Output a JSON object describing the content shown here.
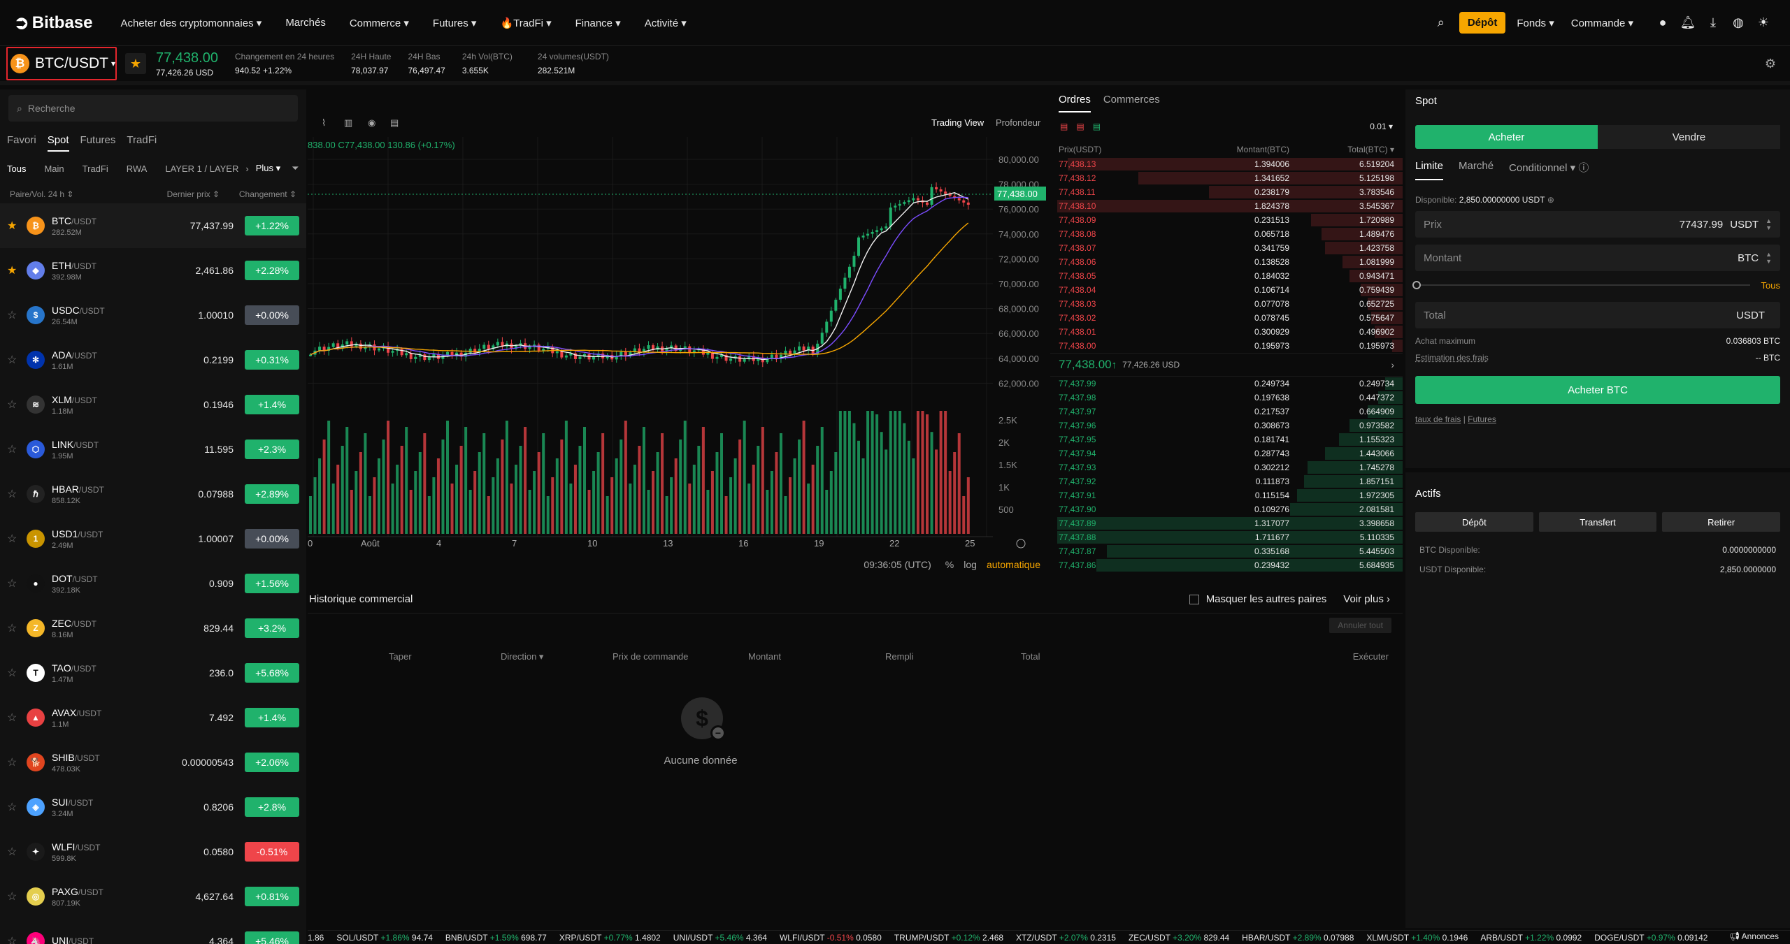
{
  "brand": {
    "name": "Bitbase"
  },
  "nav": {
    "items": [
      "Acheter des cryptomonnaies",
      "Marchés",
      "Commerce",
      "Futures",
      "TradFi",
      "Finance",
      "Activité"
    ]
  },
  "topright": {
    "depot": "Dépôt",
    "fonds": "Fonds",
    "commande": "Commande"
  },
  "ticker": {
    "pair": "BTC/USDT",
    "price": "77,438.00",
    "price_usd": "77,426.26 USD",
    "change_label": "Changement en 24 heures",
    "change_value": "940.52 +1.22%",
    "high_label": "24H Haute",
    "high_value": "78,037.97",
    "low_label": "24H Bas",
    "low_value": "76,497.47",
    "volbtc_label": "24h Vol(BTC)",
    "volbtc_value": "3.655K",
    "volusdt_label": "24 volumes(USDT)",
    "volusdt_value": "282.521M"
  },
  "market": {
    "search_placeholder": "Recherche",
    "tabs": [
      "Favori",
      "Spot",
      "Futures",
      "TradFi"
    ],
    "subtabs": [
      "Tous",
      "Main",
      "TradFi",
      "RWA",
      "LAYER 1 / LAYER"
    ],
    "plus": "Plus",
    "col_pair": "Paire/Vol. 24 h",
    "col_price": "Dernier prix",
    "col_change": "Changement",
    "rows": [
      {
        "base": "BTC",
        "quote": "/USDT",
        "vol": "282.52M",
        "price": "77,437.99",
        "change": "+1.22%",
        "dir": "up",
        "fav": true,
        "color": "#f7931a",
        "sym": "₿"
      },
      {
        "base": "ETH",
        "quote": "/USDT",
        "vol": "392.98M",
        "price": "2,461.86",
        "change": "+2.28%",
        "dir": "up",
        "fav": true,
        "color": "#627eea",
        "sym": "◆"
      },
      {
        "base": "USDC",
        "quote": "/USDT",
        "vol": "26.54M",
        "price": "1.00010",
        "change": "+0.00%",
        "dir": "flat",
        "fav": false,
        "color": "#2775ca",
        "sym": "$"
      },
      {
        "base": "ADA",
        "quote": "/USDT",
        "vol": "1.61M",
        "price": "0.2199",
        "change": "+0.31%",
        "dir": "up",
        "fav": false,
        "color": "#0033ad",
        "sym": "✻"
      },
      {
        "base": "XLM",
        "quote": "/USDT",
        "vol": "1.18M",
        "price": "0.1946",
        "change": "+1.4%",
        "dir": "up",
        "fav": false,
        "color": "#333",
        "sym": "≋"
      },
      {
        "base": "LINK",
        "quote": "/USDT",
        "vol": "1.95M",
        "price": "11.595",
        "change": "+2.3%",
        "dir": "up",
        "fav": false,
        "color": "#2a5ada",
        "sym": "⬡"
      },
      {
        "base": "HBAR",
        "quote": "/USDT",
        "vol": "858.12K",
        "price": "0.07988",
        "change": "+2.89%",
        "dir": "up",
        "fav": false,
        "color": "#222",
        "sym": "ℏ"
      },
      {
        "base": "USD1",
        "quote": "/USDT",
        "vol": "2.49M",
        "price": "1.00007",
        "change": "+0.00%",
        "dir": "flat",
        "fav": false,
        "color": "#c99400",
        "sym": "1"
      },
      {
        "base": "DOT",
        "quote": "/USDT",
        "vol": "392.18K",
        "price": "0.909",
        "change": "+1.56%",
        "dir": "up",
        "fav": false,
        "color": "#111",
        "sym": "●"
      },
      {
        "base": "ZEC",
        "quote": "/USDT",
        "vol": "8.16M",
        "price": "829.44",
        "change": "+3.2%",
        "dir": "up",
        "fav": false,
        "color": "#f4b728",
        "sym": "Z"
      },
      {
        "base": "TAO",
        "quote": "/USDT",
        "vol": "1.47M",
        "price": "236.0",
        "change": "+5.68%",
        "dir": "up",
        "fav": false,
        "color": "#fff",
        "sym": "T"
      },
      {
        "base": "AVAX",
        "quote": "/USDT",
        "vol": "1.1M",
        "price": "7.492",
        "change": "+1.4%",
        "dir": "up",
        "fav": false,
        "color": "#e84142",
        "sym": "▲"
      },
      {
        "base": "SHIB",
        "quote": "/USDT",
        "vol": "478.03K",
        "price": "0.00000543",
        "change": "+2.06%",
        "dir": "up",
        "fav": false,
        "color": "#e0451f",
        "sym": "🐕"
      },
      {
        "base": "SUI",
        "quote": "/USDT",
        "vol": "3.24M",
        "price": "0.8206",
        "change": "+2.8%",
        "dir": "up",
        "fav": false,
        "color": "#4da2ff",
        "sym": "◈"
      },
      {
        "base": "WLFI",
        "quote": "/USDT",
        "vol": "599.8K",
        "price": "0.0580",
        "change": "-0.51%",
        "dir": "down",
        "fav": false,
        "color": "#1a1a1a",
        "sym": "✦"
      },
      {
        "base": "PAXG",
        "quote": "/USDT",
        "vol": "807.19K",
        "price": "4,627.64",
        "change": "+0.81%",
        "dir": "up",
        "fav": false,
        "color": "#e4ce4e",
        "sym": "◎"
      },
      {
        "base": "UNI",
        "quote": "/USDT",
        "vol": "",
        "price": "4.364",
        "change": "+5.46%",
        "dir": "up",
        "fav": false,
        "color": "#ff007a",
        "sym": "🦄"
      }
    ]
  },
  "chart": {
    "trading_view": "Trading View",
    "profondeur": "Profondeur",
    "ohlc": "838.00  C77,438.00  130.86 (+0.17%)",
    "price_axis": [
      "80,000.00",
      "78,000.00",
      "76,000.00",
      "74,000.00",
      "72,000.00",
      "70,000.00",
      "68,000.00",
      "66,000.00",
      "64,000.00",
      "62,000.00"
    ],
    "current_price_tag": "77,438.00",
    "vol_axis": [
      "2.5K",
      "2K",
      "1.5K",
      "1K",
      "500"
    ],
    "x_axis": [
      "0",
      "Août",
      "4",
      "7",
      "10",
      "13",
      "16",
      "19",
      "22",
      "25"
    ],
    "time": "09:36:05 (UTC)",
    "pct": "%",
    "log": "log",
    "auto": "automatique"
  },
  "orderbook": {
    "tabs": [
      "Ordres",
      "Commerces"
    ],
    "precision": "0.01",
    "col_price": "Prix(USDT)",
    "col_amount": "Montant(BTC)",
    "col_total": "Total(BTC)",
    "asks": [
      [
        "77,438.13",
        "1.394006",
        "6.519204",
        0.95
      ],
      [
        "77,438.12",
        "1.341652",
        "5.125198",
        0.75
      ],
      [
        "77,438.11",
        "0.238179",
        "3.783546",
        0.55
      ],
      [
        "77,438.10",
        "1.824378",
        "3.545367",
        0.98
      ],
      [
        "77,438.09",
        "0.231513",
        "1.720989",
        0.26
      ],
      [
        "77,438.08",
        "0.065718",
        "1.489476",
        0.23
      ],
      [
        "77,438.07",
        "0.341759",
        "1.423758",
        0.22
      ],
      [
        "77,438.06",
        "0.138528",
        "1.081999",
        0.17
      ],
      [
        "77,438.05",
        "0.184032",
        "0.943471",
        0.15
      ],
      [
        "77,438.04",
        "0.106714",
        "0.759439",
        0.12
      ],
      [
        "77,438.03",
        "0.077078",
        "0.652725",
        0.1
      ],
      [
        "77,438.02",
        "0.078745",
        "0.575647",
        0.09
      ],
      [
        "77,438.01",
        "0.300929",
        "0.496902",
        0.08
      ],
      [
        "77,438.00",
        "0.195973",
        "0.195973",
        0.03
      ]
    ],
    "mid_price": "77,438.00",
    "mid_arrow": "↑",
    "mid_usd": "77,426.26 USD",
    "bids": [
      [
        "77,437.99",
        "0.249734",
        "0.249734",
        0.05
      ],
      [
        "77,437.98",
        "0.197638",
        "0.447372",
        0.07
      ],
      [
        "77,437.97",
        "0.217537",
        "0.664909",
        0.1
      ],
      [
        "77,437.96",
        "0.308673",
        "0.973582",
        0.15
      ],
      [
        "77,437.95",
        "0.181741",
        "1.155323",
        0.18
      ],
      [
        "77,437.94",
        "0.287743",
        "1.443066",
        0.22
      ],
      [
        "77,437.93",
        "0.302212",
        "1.745278",
        0.27
      ],
      [
        "77,437.92",
        "0.111873",
        "1.857151",
        0.28
      ],
      [
        "77,437.91",
        "0.115154",
        "1.972305",
        0.3
      ],
      [
        "77,437.90",
        "0.109276",
        "2.081581",
        0.32
      ],
      [
        "77,437.89",
        "1.317077",
        "3.398658",
        0.98
      ],
      [
        "77,437.88",
        "1.711677",
        "5.110335",
        0.98
      ],
      [
        "77,437.87",
        "0.335168",
        "5.445503",
        0.84
      ],
      [
        "77,437.86",
        "0.239432",
        "5.684935",
        0.87
      ]
    ]
  },
  "trade": {
    "title": "Spot",
    "buy": "Acheter",
    "sell": "Vendre",
    "order_tabs": [
      "Limite",
      "Marché",
      "Conditionnel"
    ],
    "available_label": "Disponible:",
    "available_value": "2,850.00000000 USDT",
    "price_label": "Prix",
    "price_value": "77437.99",
    "price_unit": "USDT",
    "amount_label": "Montant",
    "amount_unit": "BTC",
    "tous": "Tous",
    "total_label": "Total",
    "total_unit": "USDT",
    "max_label": "Achat maximum",
    "max_value": "0.036803 BTC",
    "fee_label": "Estimation des frais",
    "fee_value": "-- BTC",
    "buy_btn": "Acheter BTC",
    "links": [
      "taux de frais",
      "Futures"
    ],
    "assets_title": "Actifs",
    "asset_btns": [
      "Dépôt",
      "Transfert",
      "Retirer"
    ],
    "btc_label": "BTC Disponible:",
    "btc_value": "0.0000000000",
    "usdt_label": "USDT Disponible:",
    "usdt_value": "2,850.0000000"
  },
  "history": {
    "title": "Historique commercial",
    "hide_others": "Masquer les autres paires",
    "see_more": "Voir plus",
    "cancel_all": "Annuler tout",
    "cols": [
      "Taper",
      "Direction",
      "Prix de commande",
      "Montant",
      "Rempli",
      "Total",
      "Exécuter"
    ],
    "empty": "Aucune donnée"
  },
  "bottom_ticker": [
    {
      "lead": "1.86"
    },
    {
      "pair": "SOL/USDT",
      "chg": "+1.86%",
      "price": "94.74",
      "dir": "up"
    },
    {
      "pair": "BNB/USDT",
      "chg": "+1.59%",
      "price": "698.77",
      "dir": "up"
    },
    {
      "pair": "XRP/USDT",
      "chg": "+0.77%",
      "price": "1.4802",
      "dir": "up"
    },
    {
      "pair": "UNI/USDT",
      "chg": "+5.46%",
      "price": "4.364",
      "dir": "up"
    },
    {
      "pair": "WLFI/USDT",
      "chg": "-0.51%",
      "price": "0.0580",
      "dir": "down"
    },
    {
      "pair": "TRUMP/USDT",
      "chg": "+0.12%",
      "price": "2.468",
      "dir": "up"
    },
    {
      "pair": "XTZ/USDT",
      "chg": "+2.07%",
      "price": "0.2315",
      "dir": "up"
    },
    {
      "pair": "ZEC/USDT",
      "chg": "+3.20%",
      "price": "829.44",
      "dir": "up"
    },
    {
      "pair": "HBAR/USDT",
      "chg": "+2.89%",
      "price": "0.07988",
      "dir": "up"
    },
    {
      "pair": "XLM/USDT",
      "chg": "+1.40%",
      "price": "0.1946",
      "dir": "up"
    },
    {
      "pair": "ARB/USDT",
      "chg": "+1.22%",
      "price": "0.0992",
      "dir": "up"
    },
    {
      "pair": "DOGE/USDT",
      "chg": "+0.97%",
      "price": "0.09142",
      "dir": "up"
    }
  ],
  "annonces": "Annonces"
}
